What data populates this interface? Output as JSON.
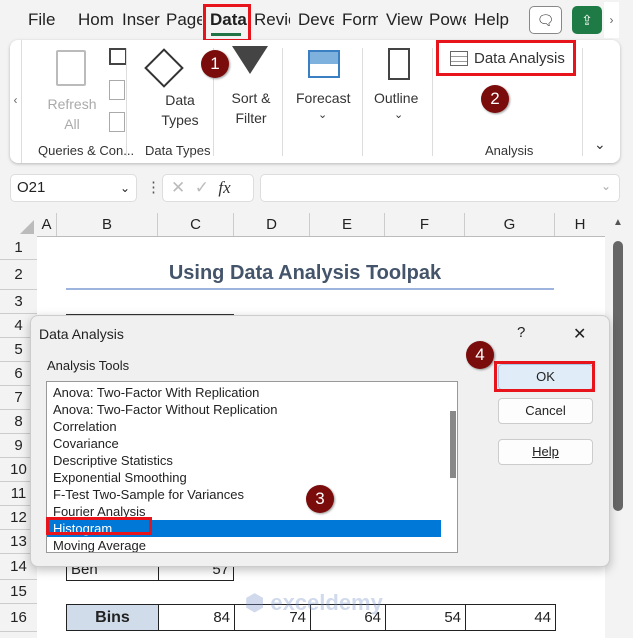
{
  "ribbon_tabs": [
    "File",
    "Hom",
    "Inser",
    "Page",
    "Data",
    "Revie",
    "Deve",
    "Form",
    "View",
    "Powe",
    "Help"
  ],
  "active_tab": "Data",
  "ribbon": {
    "refresh_all": "Refresh All",
    "queries_group": "Queries & Con...",
    "data_types": "Data Types",
    "data_types_group": "Data Types",
    "sort_filter": "Sort & Filter",
    "forecast": "Forecast",
    "outline": "Outline",
    "data_analysis": "Data Analysis",
    "analysis_group": "Analysis"
  },
  "name_box": "O21",
  "formula": "",
  "fx": "fx",
  "columns": [
    "A",
    "B",
    "C",
    "D",
    "E",
    "F",
    "G",
    "H"
  ],
  "rows": [
    "1",
    "2",
    "3",
    "4",
    "5",
    "6",
    "7",
    "8",
    "9",
    "10",
    "11",
    "12",
    "13",
    "14",
    "15",
    "16"
  ],
  "sheet": {
    "title": "Using Data Analysis Toolpak",
    "row14": {
      "name": "Ben",
      "value": "57"
    },
    "bins_label": "Bins",
    "bins": [
      "84",
      "74",
      "64",
      "54",
      "44"
    ],
    "watermark": "exceldemy"
  },
  "dialog": {
    "title": "Data Analysis",
    "help": "?",
    "close": "✕",
    "label": "Analysis Tools",
    "items": [
      "Anova: Two-Factor With Replication",
      "Anova: Two-Factor Without Replication",
      "Correlation",
      "Covariance",
      "Descriptive Statistics",
      "Exponential Smoothing",
      "F-Test Two-Sample for Variances",
      "Fourier Analysis",
      "Histogram",
      "Moving Average"
    ],
    "selected": "Histogram",
    "ok": "OK",
    "cancel": "Cancel",
    "help_btn": "Help"
  },
  "badges": [
    "1",
    "2",
    "3",
    "4"
  ],
  "colors": {
    "accent": "#217346",
    "highlight": "#e8141c",
    "badge": "#7b0c0c",
    "selection": "#0078d7",
    "bins_fill": "#d0dcea",
    "title": "#44546a"
  }
}
